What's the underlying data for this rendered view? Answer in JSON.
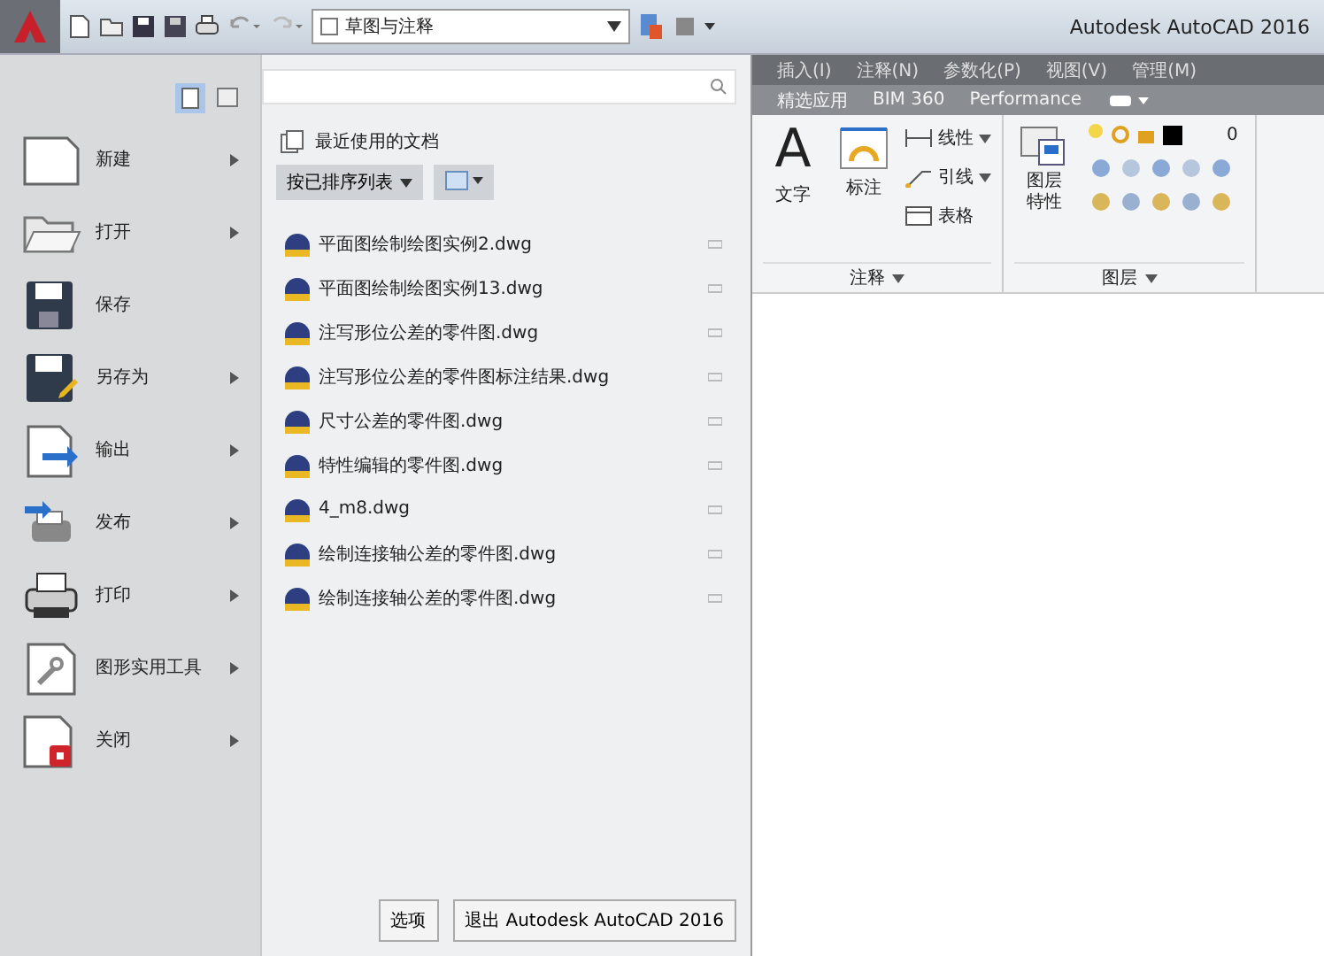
{
  "quick_access": {
    "workspace": "草图与注释"
  },
  "title": "Autodesk AutoCAD 2016",
  "app_menu": {
    "commands": [
      {
        "kind": "new",
        "label": "新建",
        "submenu": true
      },
      {
        "kind": "open",
        "label": "打开",
        "submenu": true
      },
      {
        "kind": "save",
        "label": "保存",
        "submenu": false
      },
      {
        "kind": "saveas",
        "label": "另存为",
        "submenu": true
      },
      {
        "kind": "export",
        "label": "输出",
        "submenu": true
      },
      {
        "kind": "publish",
        "label": "发布",
        "submenu": true
      },
      {
        "kind": "print",
        "label": "打印",
        "submenu": true
      },
      {
        "kind": "utilities",
        "label": "图形实用工具",
        "submenu": true
      },
      {
        "kind": "close",
        "label": "关闭",
        "submenu": true
      }
    ],
    "recent": {
      "heading": "最近使用的文档",
      "sort": "按已排序列表",
      "files": [
        {
          "name": "平面图绘制绘图实例2.dwg"
        },
        {
          "name": "平面图绘制绘图实例13.dwg"
        },
        {
          "name": "注写形位公差的零件图.dwg"
        },
        {
          "name": "注写形位公差的零件图标注结果.dwg"
        },
        {
          "name": "尺寸公差的零件图.dwg"
        },
        {
          "name": "特性编辑的零件图.dwg"
        },
        {
          "name": "4_m8.dwg"
        },
        {
          "name": "绘制连接轴公差的零件图.dwg"
        },
        {
          "name": "绘制连接轴公差的零件图.dwg"
        }
      ]
    },
    "buttons": [
      "选项",
      "退出 Autodesk AutoCAD 2016"
    ]
  },
  "ribbon": {
    "tabs_top": [
      "插入(I)",
      "注释(N)",
      "参数化(P)",
      "视图(V)",
      "管理(M)"
    ],
    "tabs": [
      "精选应用",
      "BIM 360",
      "Performance"
    ],
    "annotation": {
      "text_icon": "A",
      "text": "文字",
      "dimension": "标注",
      "linear": "线性",
      "leader": "引线",
      "table": "表格",
      "title": "注释"
    },
    "layers": {
      "properties": "图层特性",
      "layer": "0",
      "title": "图层"
    }
  }
}
